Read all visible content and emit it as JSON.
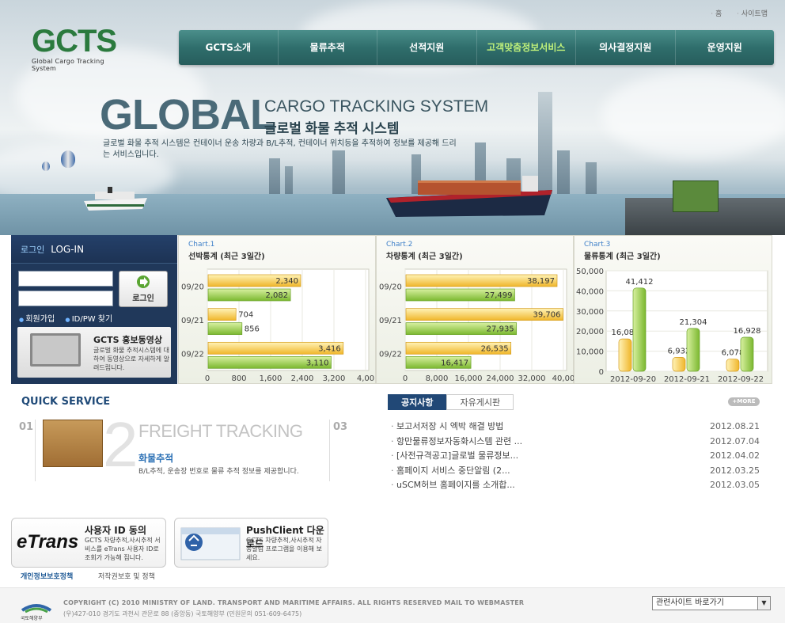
{
  "header": {
    "logo": "GCTS",
    "logo_sub": "Global Cargo Tracking System",
    "top_links": [
      "홈",
      "사이트맵"
    ],
    "nav": [
      "GCTS소개",
      "물류추적",
      "선적지원",
      "고객맞춤정보서비스",
      "의사결정지원",
      "운영지원"
    ]
  },
  "hero": {
    "big": "GLOBAL",
    "title_en": "CARGO TRACKING SYSTEM",
    "title_ko": "글로벌 화물 추적 시스템",
    "desc": "글로벌 화물 추적 시스템은 컨테이너 운송 차량과 B/L추적, 컨테이너 위치등을 추적하여 정보를 제공해 드리는 서비스입니다."
  },
  "login": {
    "title_ko": "로그인",
    "title_en": "LOG-IN",
    "button": "로그인",
    "links": [
      "회원가입",
      "ID/PW 찾기"
    ],
    "promo_title": "GCTS 홍보동영상",
    "promo_desc": "글로벌 화물 추적시스템에 대하여 동영상으로 자세하게 알려드립니다."
  },
  "chart_data": [
    {
      "type": "bar",
      "caption": "Chart.1",
      "title": "선박통계 (최근 3일간)",
      "categories": [
        "09/20",
        "09/21",
        "09/22"
      ],
      "series": [
        {
          "values": [
            2340,
            704,
            3416
          ],
          "color": "#f0b62a"
        },
        {
          "values": [
            2082,
            856,
            3110
          ],
          "color": "#8bc53f"
        }
      ],
      "xlim": [
        0,
        4000
      ],
      "ticks": [
        "0",
        "800",
        "1,600",
        "2,400",
        "3,200",
        "4,00"
      ],
      "labels": [
        [
          "2,340",
          "704",
          "3,416"
        ],
        [
          "2,082",
          "856",
          "3,110"
        ]
      ]
    },
    {
      "type": "bar",
      "caption": "Chart.2",
      "title": "차량통계 (최근 3일간)",
      "categories": [
        "09/20",
        "09/21",
        "09/22"
      ],
      "series": [
        {
          "values": [
            38197,
            39706,
            26535
          ],
          "color": "#f0b62a"
        },
        {
          "values": [
            27499,
            27935,
            16417
          ],
          "color": "#8bc53f"
        }
      ],
      "xlim": [
        0,
        40000
      ],
      "ticks": [
        "0",
        "8,000",
        "16,000",
        "24,000",
        "32,000",
        "40,00"
      ],
      "labels": [
        [
          "38,197",
          "39,706",
          "26,535"
        ],
        [
          "27,499",
          "27,935",
          "16,417"
        ]
      ]
    },
    {
      "type": "bar",
      "caption": "Chart.3",
      "title": "물류통계 (최근 3일간)",
      "categories": [
        "2012-09-20",
        "2012-09-21",
        "2012-09-22"
      ],
      "series": [
        {
          "values": [
            16081,
            6932,
            6078
          ],
          "color": "#f0b62a"
        },
        {
          "values": [
            41412,
            21304,
            16928
          ],
          "color": "#8bc53f"
        }
      ],
      "ylim": [
        0,
        50000
      ],
      "ticks": [
        "0",
        "10,000",
        "20,000",
        "30,000",
        "40,000",
        "50,000"
      ],
      "labels": [
        [
          "16,081",
          "6,932",
          "6,078"
        ],
        [
          "41,412",
          "21,304",
          "16,928"
        ]
      ]
    }
  ],
  "quick": {
    "title": "QUICK SERVICE",
    "n1": "01",
    "n2": "2",
    "n3": "03",
    "item_en": "FREIGHT TRACKING",
    "item_ko": "화물추적",
    "item_desc": "B/L추적, 운송장 번호로 물류 추적 정보를 제공합니다."
  },
  "board": {
    "tabs": [
      "공지사항",
      "자유게시판"
    ],
    "more": "+MORE",
    "items": [
      {
        "title": "보고서저장 시 엑박 해결 방법",
        "date": "2012.08.21"
      },
      {
        "title": "항만물류정보자동화시스템 관련 ...",
        "date": "2012.07.04"
      },
      {
        "title": "[사전규격공고]글로벌 물류정보...",
        "date": "2012.04.02"
      },
      {
        "title": "홈페이지 서비스 중단알림 (2...",
        "date": "2012.03.25"
      },
      {
        "title": "uSCM허브 홈페이지를 소개합...",
        "date": "2012.03.05"
      }
    ]
  },
  "links": {
    "etrans_logo": "eTrans",
    "etrans_title": "사용자 ID 동의",
    "etrans_desc": "GCTS 차량추적,사시추적 서비스를 eTrans 사용자 ID로 조회가 가능해 집니다.",
    "push_title": "PushClient 다운로드",
    "push_desc": "GCTS 차량추적,사시추적 자동알림 프로그램을 이용해 보세요."
  },
  "footer": {
    "privacy": "개인정보보호정책",
    "copyright_policy": "저작권보호 및 정책",
    "ministry": "국토해양부",
    "copyright": "COPYRIGHT (C) 2010 MINISTRY OF LAND. TRANSPORT AND MARITIME AFFAIRS. ALL RIGHTS RESERVED MAIL TO WEBMASTER",
    "address": "(우)427-010 경기도 과천시 관문로 88 (중앙동) 국토해양부 (민원문의 051-609-6475)",
    "select": "관련사이트 바로가기"
  }
}
